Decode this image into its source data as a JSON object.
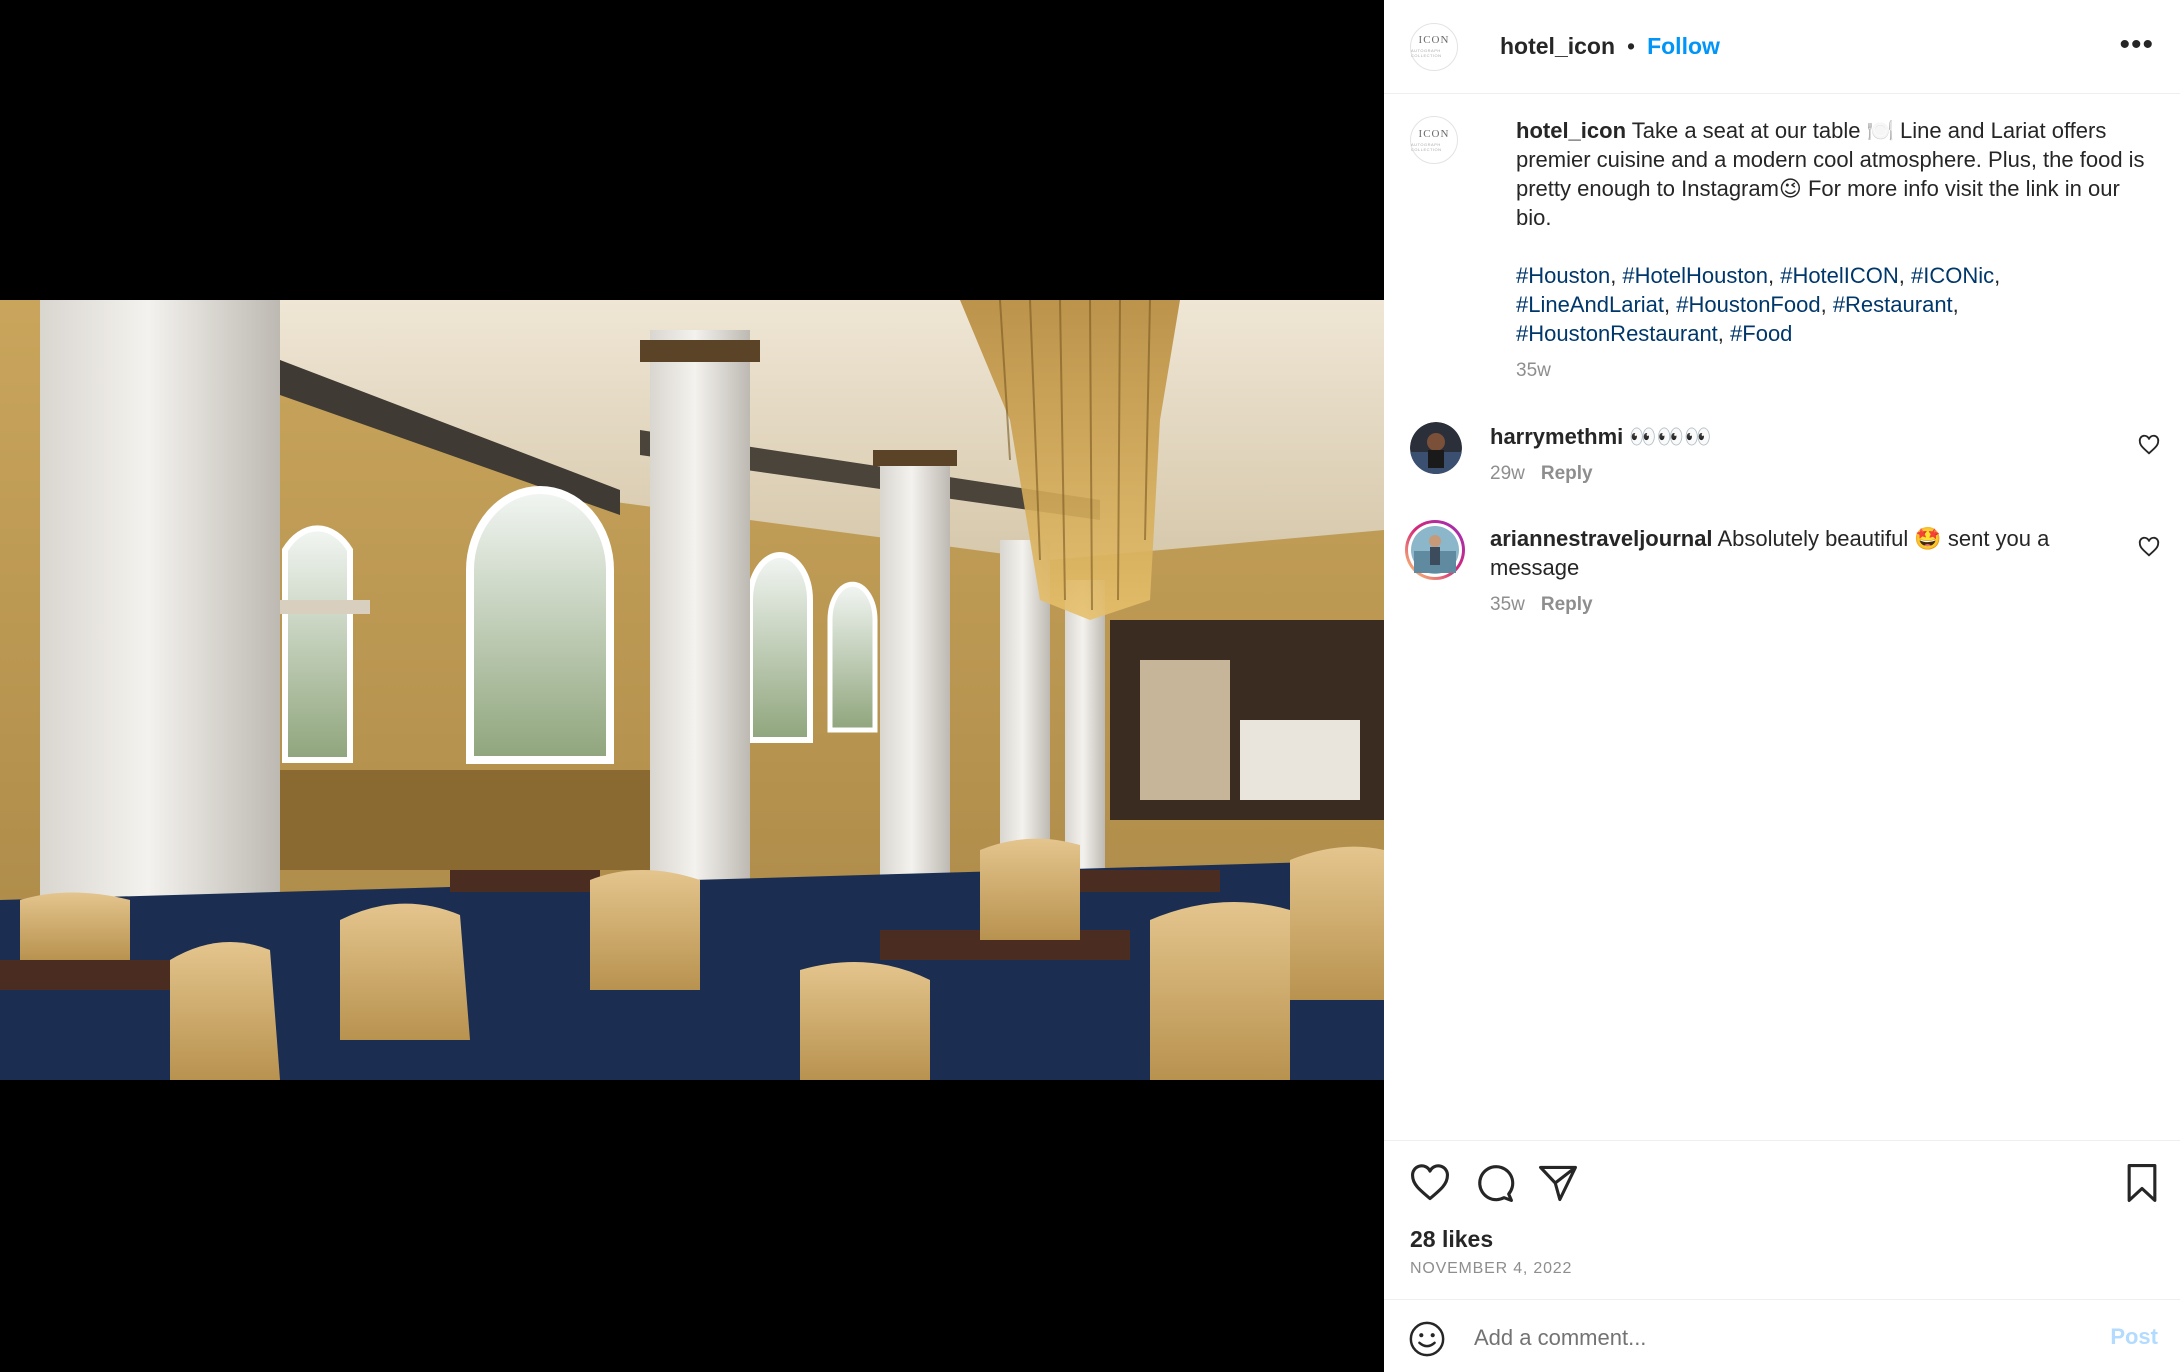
{
  "post": {
    "username": "hotel_icon",
    "follow_label": "Follow",
    "separator": "•",
    "more_label": "•••",
    "avatar_logo_text": "ICON",
    "avatar_logo_sub": "AUTOGRAPH COLLECTION"
  },
  "caption": {
    "username": "hotel_icon",
    "text": "Take a seat at our table 🍽️ Line and Lariat offers premier cuisine and a modern cool atmosphere. Plus, the food is pretty enough to Instagram😉 For more info visit the link in our bio.",
    "hashtags": [
      "#Houston",
      "#HotelHouston",
      "#HotelICON",
      "#ICONic",
      "#LineAndLariat",
      "#HoustonFood",
      "#Restaurant",
      "#HoustonRestaurant",
      "#Food"
    ],
    "time": "35w"
  },
  "comments": [
    {
      "username": "harrymethmi",
      "text": "👀👀👀",
      "time": "29w",
      "reply_label": "Reply"
    },
    {
      "username": "ariannestraveljournal",
      "text": "Absolutely beautiful 🤩 sent you a message",
      "time": "35w",
      "reply_label": "Reply"
    }
  ],
  "engagement": {
    "likes": "28 likes",
    "date": "NOVEMBER 4, 2022"
  },
  "comment_box": {
    "placeholder": "Add a comment...",
    "post_label": "Post"
  },
  "icons": [
    "more-icon",
    "heart-icon",
    "comment-icon",
    "share-icon",
    "bookmark-icon",
    "emoji-icon"
  ],
  "colors": {
    "accent": "#0095f6",
    "hashtag": "#00376b",
    "muted": "#8e8e8e",
    "post_disabled": "#b3dbff"
  }
}
